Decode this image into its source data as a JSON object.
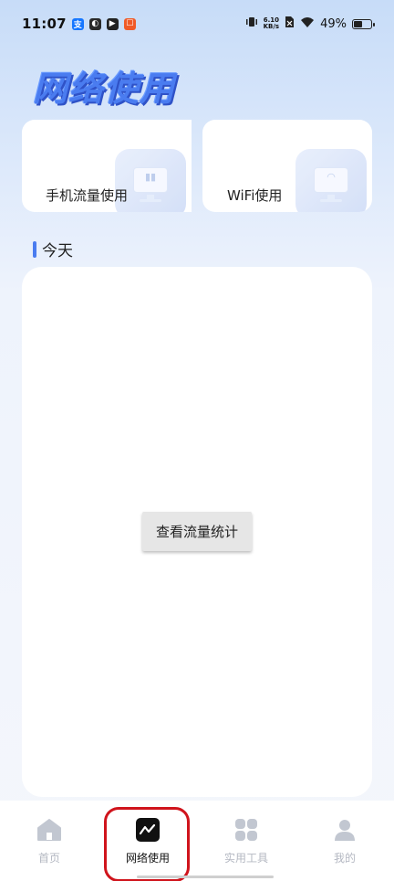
{
  "status_bar": {
    "time": "11:07",
    "net_speed_value": "6.10",
    "net_speed_unit": "KB/s",
    "battery_percent": "49%",
    "battery_level": 0.49
  },
  "page_title": "网络使用",
  "cards": [
    {
      "label": "手机流量使用",
      "icon": "chart-monitor-icon"
    },
    {
      "label": "WiFi使用",
      "icon": "wifi-monitor-icon"
    }
  ],
  "section": {
    "title": "今天"
  },
  "main": {
    "button_label": "查看流量统计"
  },
  "bottom_nav": {
    "items": [
      {
        "label": "首页",
        "icon": "home-icon",
        "active": false
      },
      {
        "label": "网络使用",
        "icon": "network-chart-icon",
        "active": true
      },
      {
        "label": "实用工具",
        "icon": "grid-icon",
        "active": false
      },
      {
        "label": "我的",
        "icon": "user-icon",
        "active": false
      }
    ]
  },
  "colors": {
    "accent": "#4a7cf0",
    "highlight": "#d0141c",
    "nav_inactive": "#b4b8c2"
  }
}
